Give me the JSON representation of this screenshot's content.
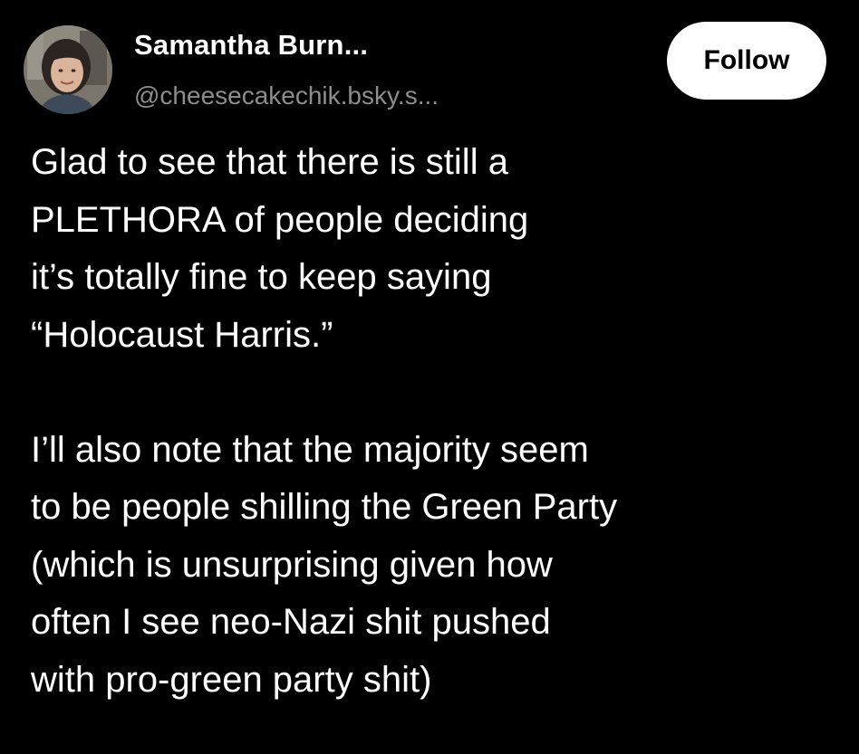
{
  "author": {
    "display_name": "Samantha Burn...",
    "handle": "@cheesecakechik.bsky.s...",
    "avatar_icon": "profile-photo"
  },
  "actions": {
    "follow_label": "Follow"
  },
  "post": {
    "paragraph_1": [
      "Glad to see that there is still a",
      "PLETHORA of people deciding",
      "it’s totally fine to keep saying",
      "“Holocaust Harris.”"
    ],
    "paragraph_2": [
      "I’ll also note that the majority seem",
      "to be people shilling the Green Party",
      "(which is unsurprising given how",
      "often I see neo-Nazi shit pushed",
      "with pro-green party shit)"
    ]
  },
  "colors": {
    "background": "#000000",
    "text": "#ffffff",
    "handle": "#8d8d8d",
    "button_bg": "#ffffff",
    "button_text": "#000000"
  }
}
